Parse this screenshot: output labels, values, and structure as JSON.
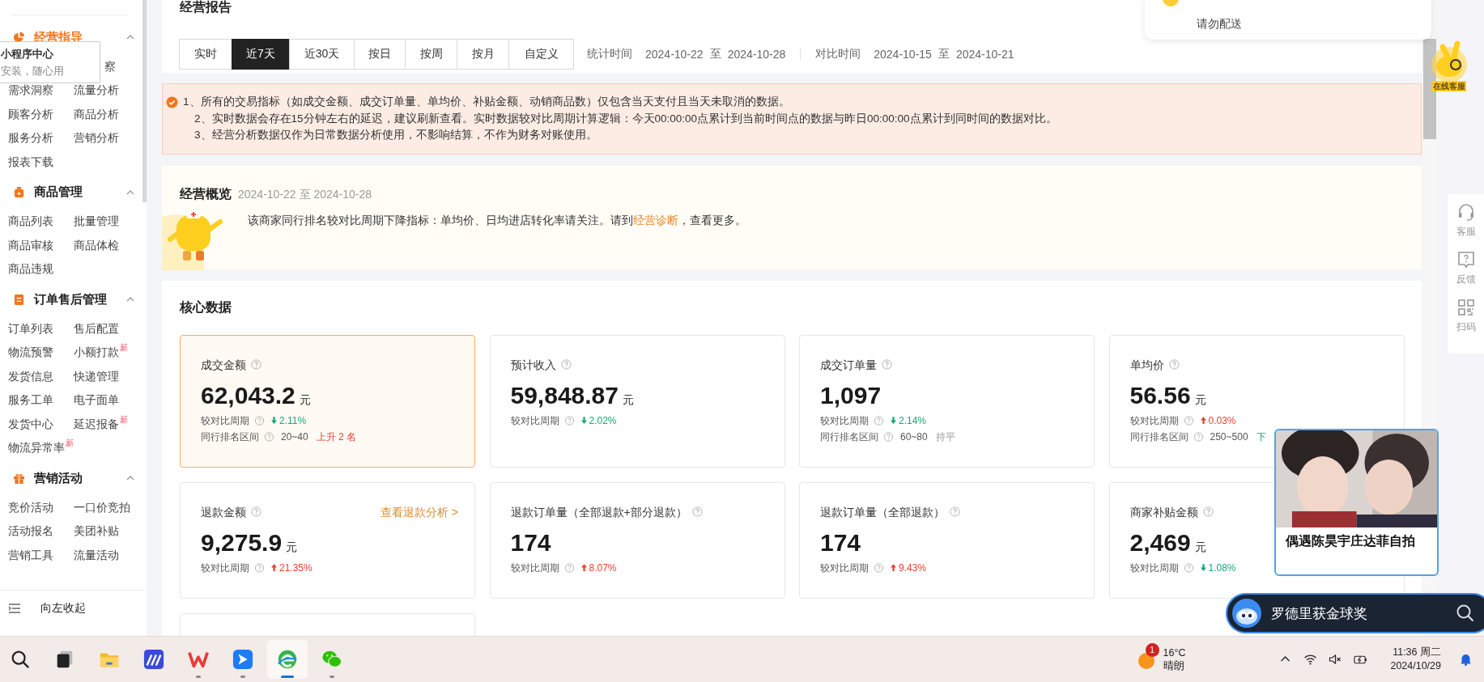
{
  "sidebar": {
    "groups": [
      {
        "title": "经营指导",
        "kind": "pie",
        "selected": true,
        "expanded": true,
        "items": [
          {
            "label": "察",
            "kind": "covered"
          },
          {
            "label": "需求洞察"
          },
          {
            "label": "流量分析"
          },
          {
            "label": "顾客分析"
          },
          {
            "label": "商品分析"
          },
          {
            "label": "服务分析"
          },
          {
            "label": "营销分析"
          },
          {
            "label": "报表下载"
          }
        ]
      },
      {
        "title": "商品管理",
        "kind": "bag",
        "selected": false,
        "expanded": true,
        "items": [
          {
            "label": "商品列表"
          },
          {
            "label": "批量管理"
          },
          {
            "label": "商品审核"
          },
          {
            "label": "商品体检"
          },
          {
            "label": "商品违规"
          }
        ]
      },
      {
        "title": "订单售后管理",
        "kind": "doc",
        "selected": false,
        "expanded": true,
        "items": [
          {
            "label": "订单列表"
          },
          {
            "label": "售后配置"
          },
          {
            "label": "物流预警"
          },
          {
            "label": "小额打款",
            "badge": "新"
          },
          {
            "label": "发货信息"
          },
          {
            "label": "快递管理"
          },
          {
            "label": "服务工单"
          },
          {
            "label": "电子面单"
          },
          {
            "label": "发货中心"
          },
          {
            "label": "延迟报备",
            "badge": "新"
          },
          {
            "label": "物流异常率",
            "badge": "新"
          }
        ]
      },
      {
        "title": "营销活动",
        "kind": "gift",
        "selected": false,
        "expanded": true,
        "items": [
          {
            "label": "竞价活动"
          },
          {
            "label": "一口价竞拍"
          },
          {
            "label": "活动报名"
          },
          {
            "label": "美团补贴"
          },
          {
            "label": "营销工具"
          },
          {
            "label": "流量活动"
          }
        ]
      }
    ],
    "popup": {
      "title": "小程序中心",
      "subtitle": "安装，随心用"
    },
    "collapse": "向左收起"
  },
  "report": {
    "title": "经营报告",
    "ranges": [
      {
        "label": "实时",
        "selected": false
      },
      {
        "label": "近7天",
        "selected": true
      },
      {
        "label": "近30天",
        "selected": false
      },
      {
        "label": "按日",
        "selected": false
      },
      {
        "label": "按周",
        "selected": false
      },
      {
        "label": "按月",
        "selected": false
      },
      {
        "label": "自定义",
        "selected": false
      }
    ],
    "periods": [
      {
        "label": "统计时间",
        "from": "2024-10-22",
        "sep": "至",
        "to": "2024-10-28"
      },
      {
        "label": "对比时间",
        "from": "2024-10-15",
        "sep": "至",
        "to": "2024-10-21"
      }
    ]
  },
  "notice": {
    "lines": [
      "1、所有的交易指标（如成交金额、成交订单量、单均价、补贴金额、动销商品数）仅包含当天支付且当天未取消的数据。",
      "2、实时数据会存在15分钟左右的延迟，建议刷新查看。实时数据较对比周期计算逻辑：今天00:00:00点累计到当前时间点的数据与昨日00:00:00点累计到同时间的数据对比。",
      "3、经营分析数据仅作为日常数据分析使用，不影响结算，不作为财务对账使用。"
    ]
  },
  "overview": {
    "title": "经营概览",
    "range": "2024-10-22 至 2024-10-28",
    "message": "该商家同行排名较对比周期下降指标：单均价、日均进店转化率请关注。请到",
    "link": "经营诊断",
    "message_end": "，查看更多。"
  },
  "core": {
    "title": "核心数据",
    "cards": [
      {
        "kind": "metric",
        "label": "成交金额",
        "value": "62,043.2",
        "unit": "元",
        "selected": true,
        "compare": {
          "label": "较对比周期",
          "rising": false,
          "value": "2.11%"
        },
        "rank": {
          "label": "同行排名区间",
          "range": "20~40",
          "kind": "up",
          "text": "上升 2 名"
        }
      },
      {
        "kind": "metric",
        "label": "预计收入",
        "value": "59,848.87",
        "unit": "元",
        "selected": false,
        "compare": {
          "label": "较对比周期",
          "rising": false,
          "value": "2.02%"
        }
      },
      {
        "kind": "metric",
        "label": "成交订单量",
        "value": "1,097",
        "selected": false,
        "compare": {
          "label": "较对比周期",
          "rising": false,
          "value": "2.14%"
        },
        "rank": {
          "label": "同行排名区间",
          "range": "60~80",
          "kind": "flat",
          "text": "持平"
        }
      },
      {
        "kind": "metric",
        "label": "单均价",
        "value": "56.56",
        "unit": "元",
        "selected": false,
        "compare": {
          "label": "较对比周期",
          "rising": true,
          "value": "0.03%"
        },
        "rank": {
          "label": "同行排名区间",
          "range": "250~500",
          "kind": "down",
          "text": "下"
        }
      },
      {
        "kind": "metric",
        "label": "退款金额",
        "value": "9,275.9",
        "unit": "元",
        "selected": false,
        "link": "查看退款分析 >",
        "compare": {
          "label": "较对比周期",
          "rising": true,
          "value": "21.35%"
        }
      },
      {
        "kind": "metric",
        "label": "退款订单量（全部退款+部分退款）",
        "value": "174",
        "selected": false,
        "compare": {
          "label": "较对比周期",
          "rising": true,
          "value": "8.07%"
        }
      },
      {
        "kind": "metric",
        "label": "退款订单量（全部退款）",
        "value": "174",
        "selected": false,
        "compare": {
          "label": "较对比周期",
          "rising": true,
          "value": "9.43%"
        }
      },
      {
        "kind": "metric",
        "label": "商家补贴金额",
        "value": "2,469",
        "unit": "元",
        "selected": false,
        "compare": {
          "label": "较对比周期",
          "rising": false,
          "value": "1.08%"
        }
      },
      {
        "kind": "empty"
      }
    ]
  },
  "notification": {
    "text": "请勿配送"
  },
  "assistant": {
    "label": "在线客服"
  },
  "rail": [
    {
      "kind": "headset",
      "label": "客服"
    },
    {
      "kind": "feedback",
      "label": "反馈"
    },
    {
      "kind": "scan",
      "label": "扫码"
    }
  ],
  "video": {
    "caption": "偶遇陈昊宇庄达菲自拍"
  },
  "hot_search": {
    "text": "罗德里获金球奖"
  },
  "taskbar": {
    "apps": [
      {
        "kind": "search",
        "running": false,
        "active": false
      },
      {
        "kind": "taskview",
        "running": false,
        "active": false
      },
      {
        "kind": "folder",
        "running": false,
        "active": false
      },
      {
        "kind": "mapp",
        "running": false,
        "active": false
      },
      {
        "kind": "wps",
        "running": true,
        "active": false
      },
      {
        "kind": "bird",
        "running": true,
        "active": false
      },
      {
        "kind": "edge",
        "running": true,
        "active": true
      },
      {
        "kind": "wechat",
        "running": true,
        "active": false
      }
    ],
    "weather": {
      "badge": "1",
      "temp": "16°C",
      "desc": "晴朗"
    },
    "time": "11:36 周二",
    "date": "2024/10/29"
  }
}
